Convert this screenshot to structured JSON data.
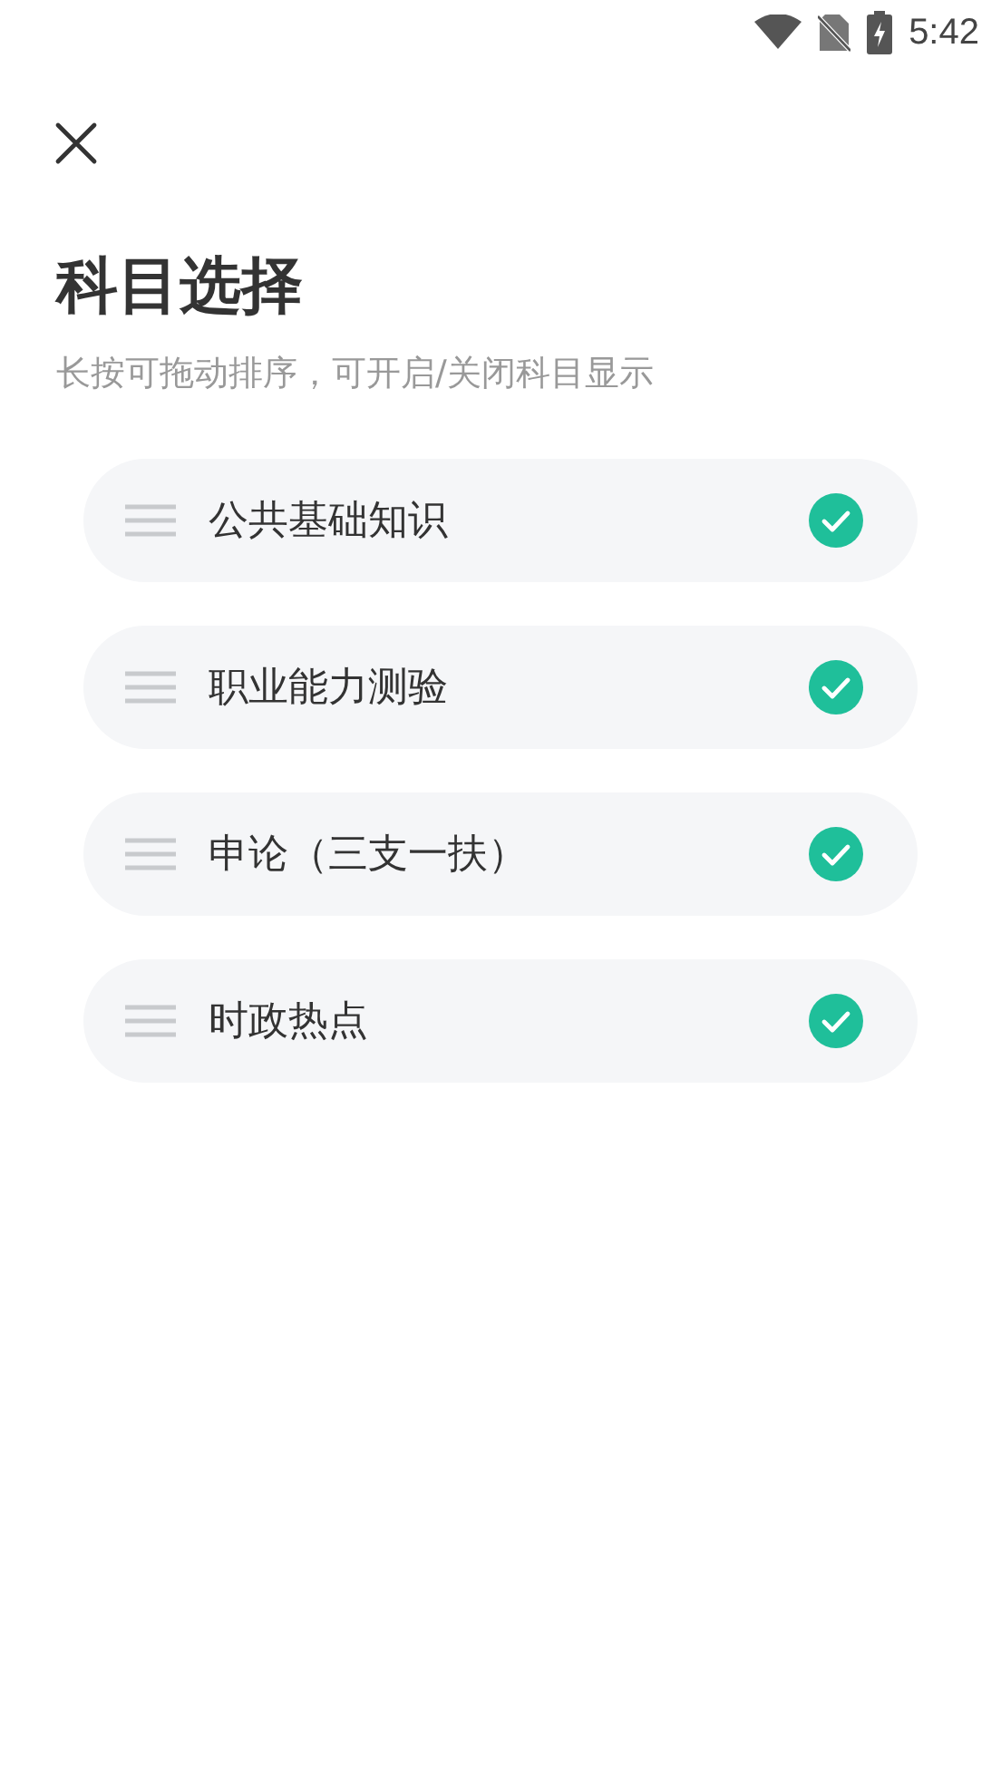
{
  "status_bar": {
    "time": "5:42"
  },
  "title": "科目选择",
  "subtitle": "长按可拖动排序，可开启/关闭科目显示",
  "subjects": [
    {
      "name": "公共基础知识",
      "checked": true
    },
    {
      "name": "职业能力测验",
      "checked": true
    },
    {
      "name": "申论（三支一扶）",
      "checked": true
    },
    {
      "name": "时政热点",
      "checked": true
    }
  ]
}
